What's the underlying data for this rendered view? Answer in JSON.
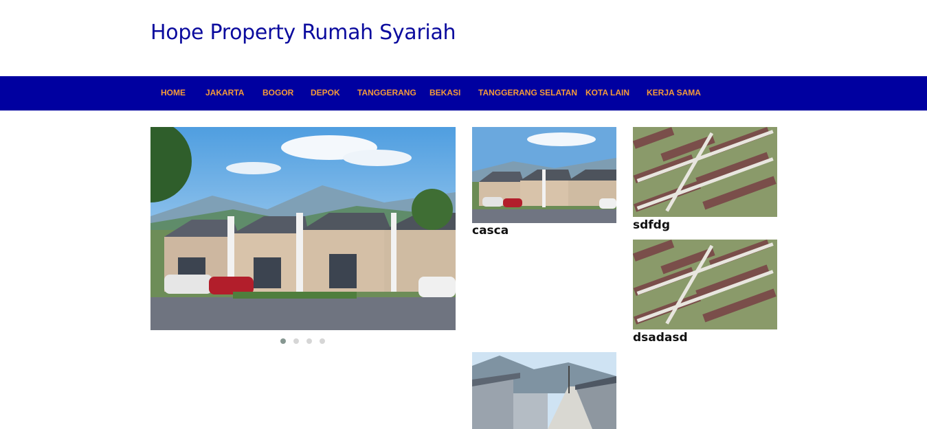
{
  "site": {
    "title": "Hope Property Rumah Syariah"
  },
  "nav": {
    "items": [
      "HOME",
      "JAKARTA",
      "BOGOR",
      "DEPOK",
      "TANGGERANG",
      "BEKASI",
      "TANGGERANG SELATAN",
      "KOTA LAIN",
      "KERJA SAMA"
    ]
  },
  "slider": {
    "slide_count": 4,
    "active_slide": 1
  },
  "posts": [
    {
      "title": "casca"
    },
    {
      "title": "sdfdg"
    },
    {
      "title": "dsadasd"
    }
  ],
  "colors": {
    "navbar": "#0000a0",
    "nav_text": "#f59b3a",
    "title": "#0b0b9e"
  }
}
